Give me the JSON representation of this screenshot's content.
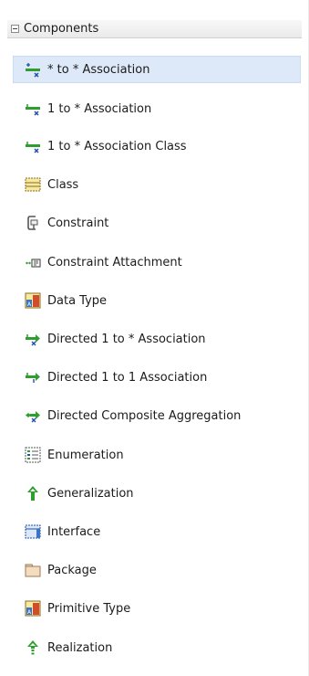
{
  "palette": {
    "header_title": "Components",
    "items": [
      {
        "label": "* to * Association",
        "icon": "association-many-many-icon",
        "selected": true
      },
      {
        "label": "1 to * Association",
        "icon": "association-one-many-icon"
      },
      {
        "label": "1 to * Association Class",
        "icon": "association-class-icon"
      },
      {
        "label": "Class",
        "icon": "class-icon"
      },
      {
        "label": "Constraint",
        "icon": "constraint-icon"
      },
      {
        "label": "Constraint Attachment",
        "icon": "constraint-attachment-icon"
      },
      {
        "label": "Data Type",
        "icon": "data-type-icon"
      },
      {
        "label": "Directed 1 to * Association",
        "icon": "directed-one-many-association-icon"
      },
      {
        "label": "Directed 1 to 1 Association",
        "icon": "directed-one-one-association-icon"
      },
      {
        "label": "Directed Composite Aggregation",
        "icon": "directed-composite-aggregation-icon"
      },
      {
        "label": "Enumeration",
        "icon": "enumeration-icon"
      },
      {
        "label": "Generalization",
        "icon": "generalization-icon"
      },
      {
        "label": "Interface",
        "icon": "interface-icon"
      },
      {
        "label": "Package",
        "icon": "package-icon"
      },
      {
        "label": "Primitive Type",
        "icon": "primitive-type-icon"
      },
      {
        "label": "Realization",
        "icon": "realization-icon"
      }
    ]
  },
  "colors": {
    "selection_bg": "#dde9f8",
    "icon_green": "#2e9e2e",
    "icon_blue": "#1f4fa8",
    "icon_yellow": "#f7e9a0"
  }
}
